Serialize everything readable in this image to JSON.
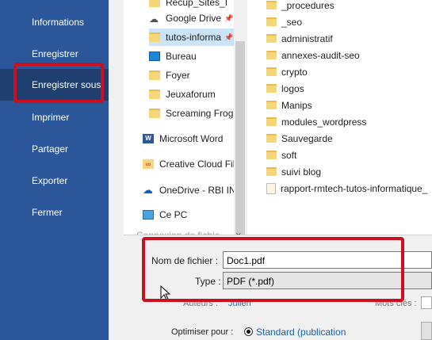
{
  "backstage": {
    "items": [
      {
        "label": "Informations"
      },
      {
        "label": "Enregistrer"
      },
      {
        "label": "Enregistrer sous"
      },
      {
        "label": "Imprimer"
      },
      {
        "label": "Partager"
      },
      {
        "label": "Exporter"
      },
      {
        "label": "Fermer"
      }
    ]
  },
  "nav": {
    "items": [
      {
        "label": "Recup_Sites_I",
        "icon": "folder-icon"
      },
      {
        "label": "Google Drive",
        "icon": "cloud-icon"
      },
      {
        "label": "tutos-informa",
        "icon": "folder-icon"
      },
      {
        "label": "Bureau",
        "icon": "desktop-icon"
      },
      {
        "label": "Foyer",
        "icon": "folder-icon"
      },
      {
        "label": "Jeuxaforum",
        "icon": "folder-icon"
      },
      {
        "label": "Screaming Frog",
        "icon": "folder-icon"
      },
      {
        "label": "Microsoft Word",
        "icon": "word-icon"
      },
      {
        "label": "Creative Cloud Fil",
        "icon": "creative-cloud-icon"
      },
      {
        "label": "OneDrive - RBI INI",
        "icon": "onedrive-icon"
      },
      {
        "label": "Ce PC",
        "icon": "pc-icon"
      },
      {
        "label": "Connexion de fichie",
        "icon": "folder-icon"
      }
    ]
  },
  "files": {
    "items": [
      {
        "label": "_procedures",
        "type": "folder"
      },
      {
        "label": "_seo",
        "type": "folder"
      },
      {
        "label": "administratif",
        "type": "folder"
      },
      {
        "label": "annexes-audit-seo",
        "type": "folder"
      },
      {
        "label": "crypto",
        "type": "folder"
      },
      {
        "label": "logos",
        "type": "folder"
      },
      {
        "label": "Manips",
        "type": "folder"
      },
      {
        "label": "modules_wordpress",
        "type": "folder"
      },
      {
        "label": "Sauvegarde",
        "type": "folder"
      },
      {
        "label": "soft",
        "type": "folder"
      },
      {
        "label": "suivi blog",
        "type": "folder"
      },
      {
        "label": "rapport-rmtech-tutos-informatique_",
        "type": "pdf"
      }
    ]
  },
  "form": {
    "filename_label": "Nom de fichier :",
    "filename_value": "Doc1.pdf",
    "type_label": "Type :",
    "type_value": "PDF (*.pdf)",
    "authors_label": "Auteurs :",
    "authors_value": "Julien",
    "tags_label": "Mots clés :",
    "optimize_label": "Optimiser pour :",
    "optimize_value": "Standard (publication"
  },
  "colors": {
    "backstage": "#2b579a",
    "highlight": "#cc0f1f",
    "selection": "#cce4f7"
  }
}
